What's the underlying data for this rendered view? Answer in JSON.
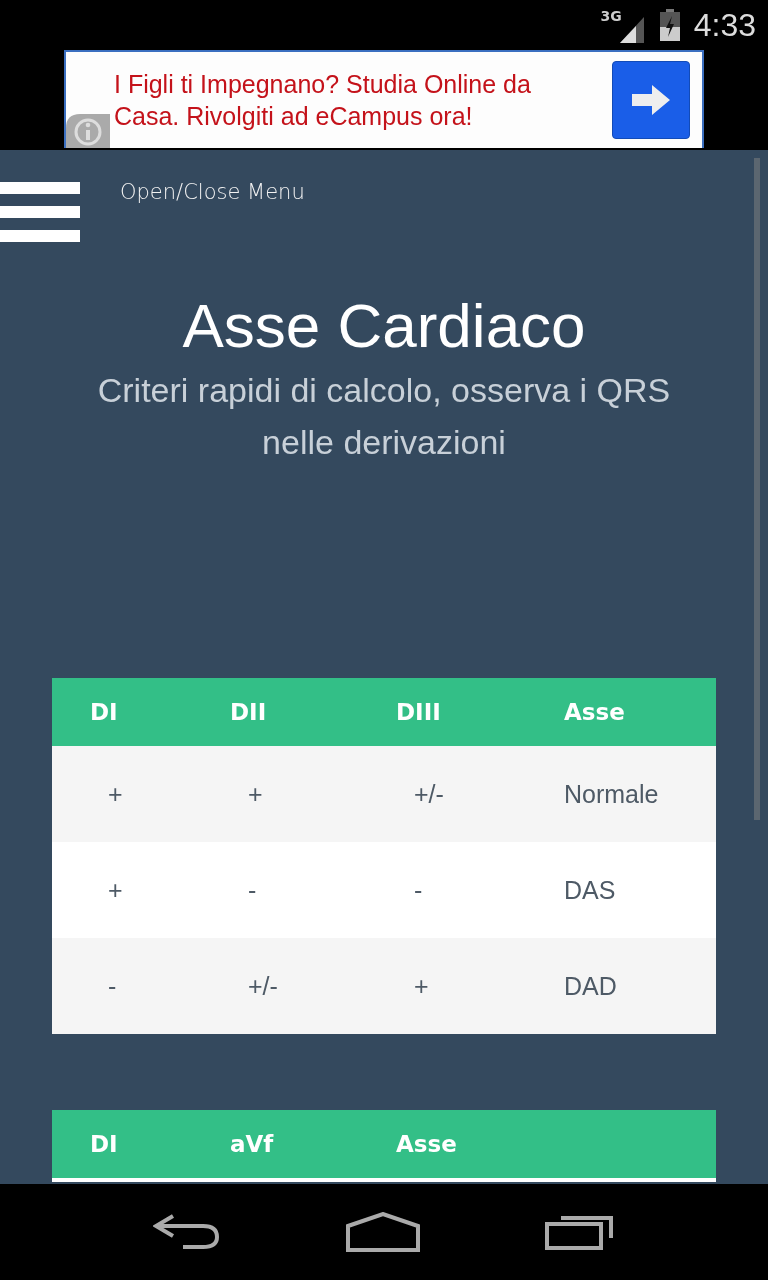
{
  "status_bar": {
    "network": "3G",
    "time": "4:33"
  },
  "ad": {
    "text": "I Figli ti Impegnano? Studia Online da Casa. Rivolgiti ad eCampus ora!"
  },
  "menu": {
    "label": "Open/Close Menu"
  },
  "header": {
    "title": "Asse Cardiaco",
    "subtitle": "Criteri rapidi di calcolo, osserva i QRS nelle derivazioni"
  },
  "tables": [
    {
      "columns": [
        "DI",
        "DII",
        "DIII",
        "Asse"
      ],
      "rows": [
        [
          "+",
          "+",
          "+/-",
          "Normale"
        ],
        [
          "+",
          "-",
          "-",
          "DAS"
        ],
        [
          "-",
          "+/-",
          "+",
          "DAD"
        ]
      ]
    },
    {
      "columns": [
        "DI",
        "aVf",
        "Asse"
      ]
    }
  ]
}
